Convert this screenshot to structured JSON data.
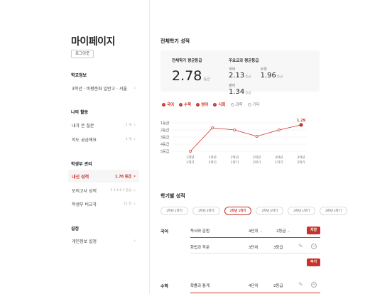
{
  "sidebar": {
    "title": "마이페이지",
    "logout": "로그아웃",
    "school_info": {
      "heading": "학교정보",
      "item": {
        "label": "3학년 · 비평준화 일반고 · 서울"
      }
    },
    "my_activity": {
      "heading": "나의 활동",
      "items": [
        {
          "label": "내가 쓴 질문",
          "value": "1 개"
        },
        {
          "label": "저도 궁금해요",
          "value": "4 개"
        }
      ]
    },
    "records": {
      "heading": "학생부 관리",
      "items": [
        {
          "label": "내신 성적",
          "value": "1.78 등급"
        },
        {
          "label": "모의고사 성적",
          "value": "2 3 4 6 1 등급"
        },
        {
          "label": "학생부 비교과",
          "value": "15 점"
        }
      ]
    },
    "settings": {
      "heading": "설정",
      "items": [
        {
          "label": "개인정보 설정"
        }
      ]
    }
  },
  "overall": {
    "title": "전체학기 성적",
    "avg_caption": "전체학기 평균등급",
    "avg_value": "2.78",
    "unit": "등급",
    "major_caption": "주요교과 평균등급",
    "subjects": [
      {
        "name": "국어",
        "value": "2.13"
      },
      {
        "name": "수학",
        "value": "1.96"
      },
      {
        "name": "영어",
        "value": "1.34"
      }
    ]
  },
  "legend": [
    {
      "label": "국어",
      "on": true
    },
    {
      "label": "수학",
      "on": true
    },
    {
      "label": "영어",
      "on": true
    },
    {
      "label": "사회",
      "on": true
    },
    {
      "label": "과학",
      "on": false
    },
    {
      "label": "기타",
      "on": false
    }
  ],
  "chart_data": {
    "type": "line",
    "categories": [
      "1학년 1학기",
      "1학년 2학기",
      "2학년 1학기",
      "2학년 2학기",
      "3학년 1학기",
      "3학년 2학기"
    ],
    "series": [
      {
        "values": [
          5,
          1.7,
          2,
          2.9,
          2,
          1.29
        ]
      }
    ],
    "y_ticks": [
      "1등급",
      "2등급",
      "3등급",
      "4등급",
      "5등급"
    ],
    "ylim": [
      1,
      5
    ],
    "y_inverted": true,
    "highlight_label": "1.29",
    "color": "#c8322a",
    "grid": true
  },
  "semester": {
    "title": "학기별 성적",
    "tabs": [
      "1학년 1학기",
      "1학년 2학기",
      "2학년 1학기",
      "2학년 2학기",
      "3학년 1학기",
      "3학년 2학기"
    ],
    "active_tab": 2,
    "groups": [
      {
        "subject": "국어",
        "rows": [
          {
            "course": "독서와 문법",
            "units": "4단위",
            "grade": "2등급",
            "mode": "edit"
          },
          {
            "course": "화법과 작문",
            "units": "3단위",
            "grade": "3등급",
            "mode": "view"
          }
        ]
      },
      {
        "subject": "수학",
        "rows": [
          {
            "course": "확률과 통계",
            "units": "4단위",
            "grade": "2등급",
            "mode": "view"
          }
        ]
      }
    ],
    "save_label": "저장",
    "add_label": "추가"
  }
}
